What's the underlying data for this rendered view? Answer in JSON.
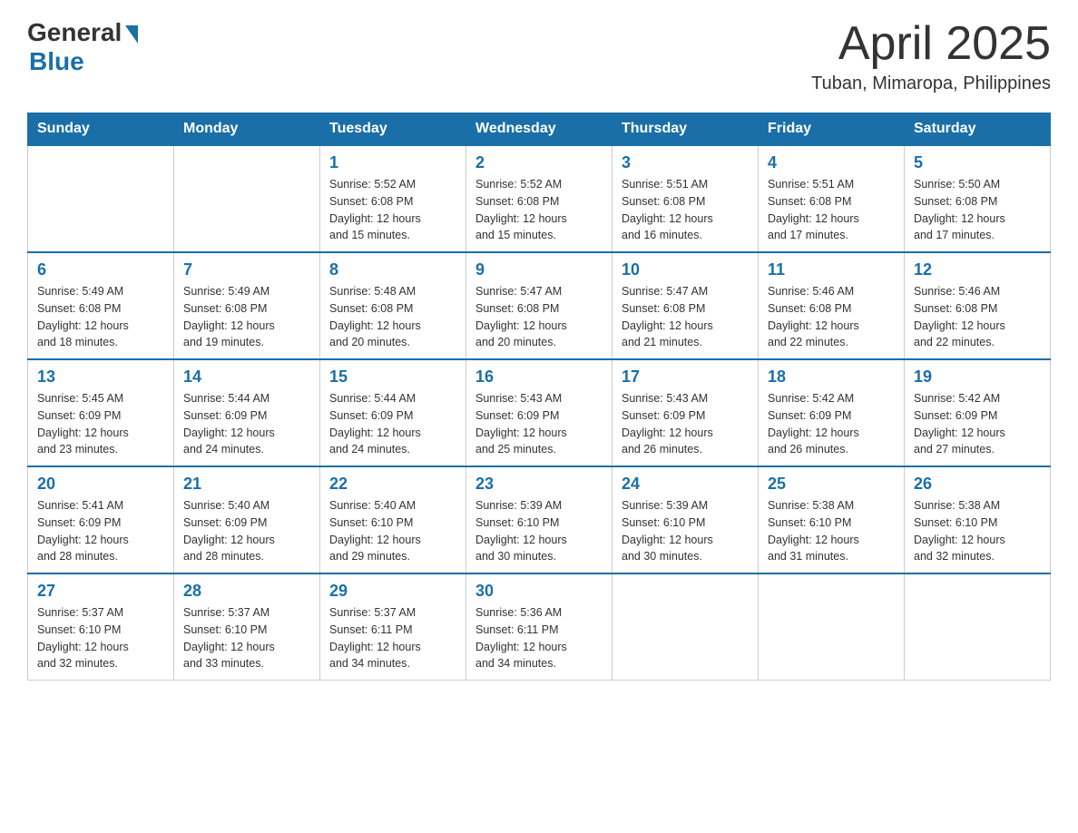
{
  "header": {
    "logo_general": "General",
    "logo_blue": "Blue",
    "month_year": "April 2025",
    "location": "Tuban, Mimaropa, Philippines"
  },
  "weekdays": [
    "Sunday",
    "Monday",
    "Tuesday",
    "Wednesday",
    "Thursday",
    "Friday",
    "Saturday"
  ],
  "weeks": [
    [
      {
        "day": "",
        "info": ""
      },
      {
        "day": "",
        "info": ""
      },
      {
        "day": "1",
        "info": "Sunrise: 5:52 AM\nSunset: 6:08 PM\nDaylight: 12 hours\nand 15 minutes."
      },
      {
        "day": "2",
        "info": "Sunrise: 5:52 AM\nSunset: 6:08 PM\nDaylight: 12 hours\nand 15 minutes."
      },
      {
        "day": "3",
        "info": "Sunrise: 5:51 AM\nSunset: 6:08 PM\nDaylight: 12 hours\nand 16 minutes."
      },
      {
        "day": "4",
        "info": "Sunrise: 5:51 AM\nSunset: 6:08 PM\nDaylight: 12 hours\nand 17 minutes."
      },
      {
        "day": "5",
        "info": "Sunrise: 5:50 AM\nSunset: 6:08 PM\nDaylight: 12 hours\nand 17 minutes."
      }
    ],
    [
      {
        "day": "6",
        "info": "Sunrise: 5:49 AM\nSunset: 6:08 PM\nDaylight: 12 hours\nand 18 minutes."
      },
      {
        "day": "7",
        "info": "Sunrise: 5:49 AM\nSunset: 6:08 PM\nDaylight: 12 hours\nand 19 minutes."
      },
      {
        "day": "8",
        "info": "Sunrise: 5:48 AM\nSunset: 6:08 PM\nDaylight: 12 hours\nand 20 minutes."
      },
      {
        "day": "9",
        "info": "Sunrise: 5:47 AM\nSunset: 6:08 PM\nDaylight: 12 hours\nand 20 minutes."
      },
      {
        "day": "10",
        "info": "Sunrise: 5:47 AM\nSunset: 6:08 PM\nDaylight: 12 hours\nand 21 minutes."
      },
      {
        "day": "11",
        "info": "Sunrise: 5:46 AM\nSunset: 6:08 PM\nDaylight: 12 hours\nand 22 minutes."
      },
      {
        "day": "12",
        "info": "Sunrise: 5:46 AM\nSunset: 6:08 PM\nDaylight: 12 hours\nand 22 minutes."
      }
    ],
    [
      {
        "day": "13",
        "info": "Sunrise: 5:45 AM\nSunset: 6:09 PM\nDaylight: 12 hours\nand 23 minutes."
      },
      {
        "day": "14",
        "info": "Sunrise: 5:44 AM\nSunset: 6:09 PM\nDaylight: 12 hours\nand 24 minutes."
      },
      {
        "day": "15",
        "info": "Sunrise: 5:44 AM\nSunset: 6:09 PM\nDaylight: 12 hours\nand 24 minutes."
      },
      {
        "day": "16",
        "info": "Sunrise: 5:43 AM\nSunset: 6:09 PM\nDaylight: 12 hours\nand 25 minutes."
      },
      {
        "day": "17",
        "info": "Sunrise: 5:43 AM\nSunset: 6:09 PM\nDaylight: 12 hours\nand 26 minutes."
      },
      {
        "day": "18",
        "info": "Sunrise: 5:42 AM\nSunset: 6:09 PM\nDaylight: 12 hours\nand 26 minutes."
      },
      {
        "day": "19",
        "info": "Sunrise: 5:42 AM\nSunset: 6:09 PM\nDaylight: 12 hours\nand 27 minutes."
      }
    ],
    [
      {
        "day": "20",
        "info": "Sunrise: 5:41 AM\nSunset: 6:09 PM\nDaylight: 12 hours\nand 28 minutes."
      },
      {
        "day": "21",
        "info": "Sunrise: 5:40 AM\nSunset: 6:09 PM\nDaylight: 12 hours\nand 28 minutes."
      },
      {
        "day": "22",
        "info": "Sunrise: 5:40 AM\nSunset: 6:10 PM\nDaylight: 12 hours\nand 29 minutes."
      },
      {
        "day": "23",
        "info": "Sunrise: 5:39 AM\nSunset: 6:10 PM\nDaylight: 12 hours\nand 30 minutes."
      },
      {
        "day": "24",
        "info": "Sunrise: 5:39 AM\nSunset: 6:10 PM\nDaylight: 12 hours\nand 30 minutes."
      },
      {
        "day": "25",
        "info": "Sunrise: 5:38 AM\nSunset: 6:10 PM\nDaylight: 12 hours\nand 31 minutes."
      },
      {
        "day": "26",
        "info": "Sunrise: 5:38 AM\nSunset: 6:10 PM\nDaylight: 12 hours\nand 32 minutes."
      }
    ],
    [
      {
        "day": "27",
        "info": "Sunrise: 5:37 AM\nSunset: 6:10 PM\nDaylight: 12 hours\nand 32 minutes."
      },
      {
        "day": "28",
        "info": "Sunrise: 5:37 AM\nSunset: 6:10 PM\nDaylight: 12 hours\nand 33 minutes."
      },
      {
        "day": "29",
        "info": "Sunrise: 5:37 AM\nSunset: 6:11 PM\nDaylight: 12 hours\nand 34 minutes."
      },
      {
        "day": "30",
        "info": "Sunrise: 5:36 AM\nSunset: 6:11 PM\nDaylight: 12 hours\nand 34 minutes."
      },
      {
        "day": "",
        "info": ""
      },
      {
        "day": "",
        "info": ""
      },
      {
        "day": "",
        "info": ""
      }
    ]
  ]
}
